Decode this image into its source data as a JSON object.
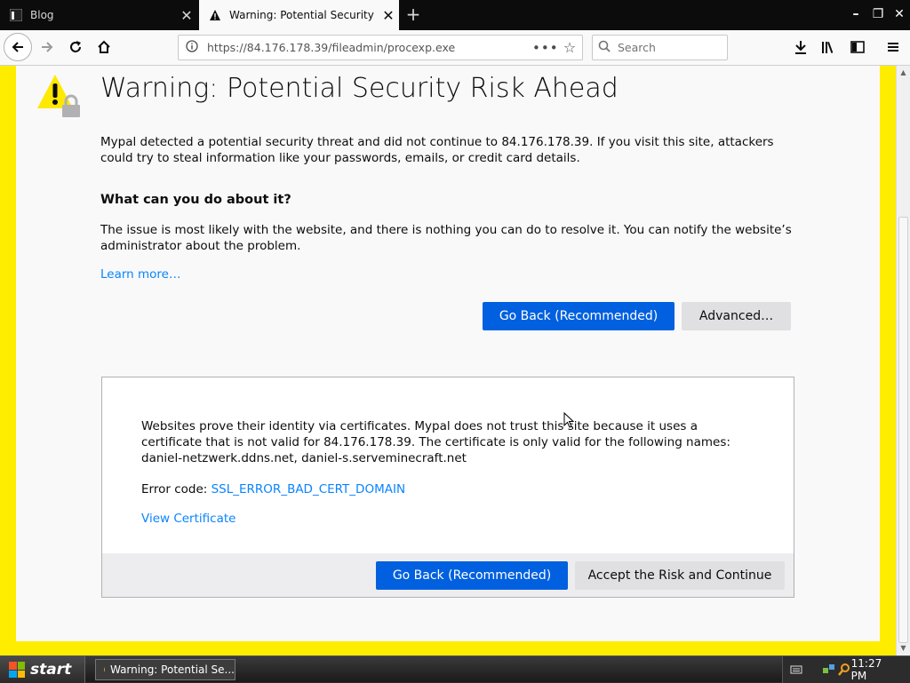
{
  "tabs": [
    {
      "title": "Blog",
      "close": "✕"
    },
    {
      "title": "Warning: Potential Security Risk A",
      "close": "✕"
    }
  ],
  "new_tab_label": "+",
  "window_controls": {
    "minimize": "–",
    "restore": "❐",
    "close": "✕"
  },
  "nav": {
    "url": "https://84.176.178.39/fileadmin/procexp.exe",
    "page_actions": "•••",
    "search_placeholder": "Search"
  },
  "page": {
    "title": "Warning: Potential Security Risk Ahead",
    "description": "Mypal detected a potential security threat and did not continue to 84.176.178.39. If you visit this site, attackers could try to steal information like your passwords, emails, or credit card details.",
    "subheading": "What can you do about it?",
    "issue_text": "The issue is most likely with the website, and there is nothing you can do to resolve it. You can notify the website’s administrator about the problem.",
    "learn_more": "Learn more…",
    "go_back_label": "Go Back (Recommended)",
    "advanced_label": "Advanced…",
    "advanced_panel": {
      "text": "Websites prove their identity via certificates. Mypal does not trust this site because it uses a certificate that is not valid for 84.176.178.39. The certificate is only valid for the following names: daniel-netzwerk.ddns.net, daniel-s.serveminecraft.net",
      "error_code_label": "Error code: ",
      "error_code": "SSL_ERROR_BAD_CERT_DOMAIN",
      "view_certificate": "View Certificate",
      "go_back_label": "Go Back (Recommended)",
      "accept_label": "Accept the Risk and Continue"
    }
  },
  "taskbar": {
    "start_label": "start",
    "task_item": "Warning: Potential Se...",
    "clock": "11:27 PM"
  },
  "colors": {
    "page_border": "#ffed00",
    "primary_button": "#0060df",
    "link": "#0a84ff"
  }
}
